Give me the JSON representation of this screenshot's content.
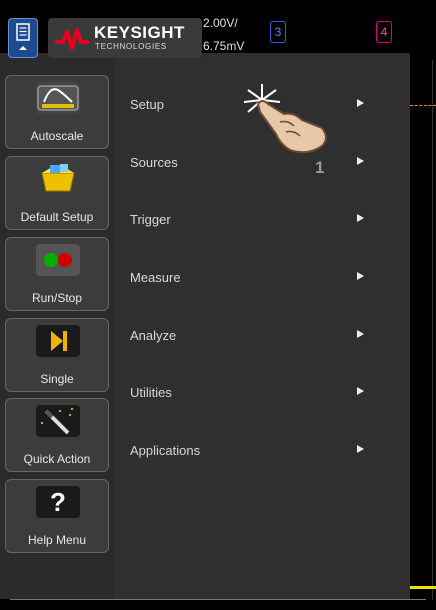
{
  "window": {
    "brand": "KEYSIGHT",
    "brand_sub": "TECHNOLOGIES"
  },
  "channels": {
    "scale_line1": "2.00V/",
    "scale_line2": "6.75mV",
    "ch3": "3",
    "ch4": "4",
    "ch3_color": "#3060e0",
    "ch4_color": "#e0008c"
  },
  "toolbar": {
    "autoscale_label": "Autoscale",
    "default_setup_label": "Default Setup",
    "run_stop_label": "Run/Stop",
    "single_label": "Single",
    "quick_action_label": "Quick Action",
    "help_menu_label": "Help Menu"
  },
  "menu": {
    "items": [
      {
        "label": "Setup"
      },
      {
        "label": "Sources"
      },
      {
        "label": "Trigger"
      },
      {
        "label": "Measure"
      },
      {
        "label": "Analyze"
      },
      {
        "label": "Utilities"
      },
      {
        "label": "Applications"
      }
    ]
  },
  "annotation": {
    "step": "1"
  },
  "icons": {
    "menu": "menu-icon",
    "autoscale": "autoscale-icon",
    "default_setup": "default-setup-icon",
    "run_stop": "run-stop-icon",
    "single": "single-icon",
    "quick_action": "quick-action-icon",
    "help": "help-icon",
    "touch": "touch-hand-icon"
  },
  "colors": {
    "accent": "#1d4b8f",
    "run": "#00b000",
    "stop": "#d00000",
    "single": "#f0b400"
  }
}
